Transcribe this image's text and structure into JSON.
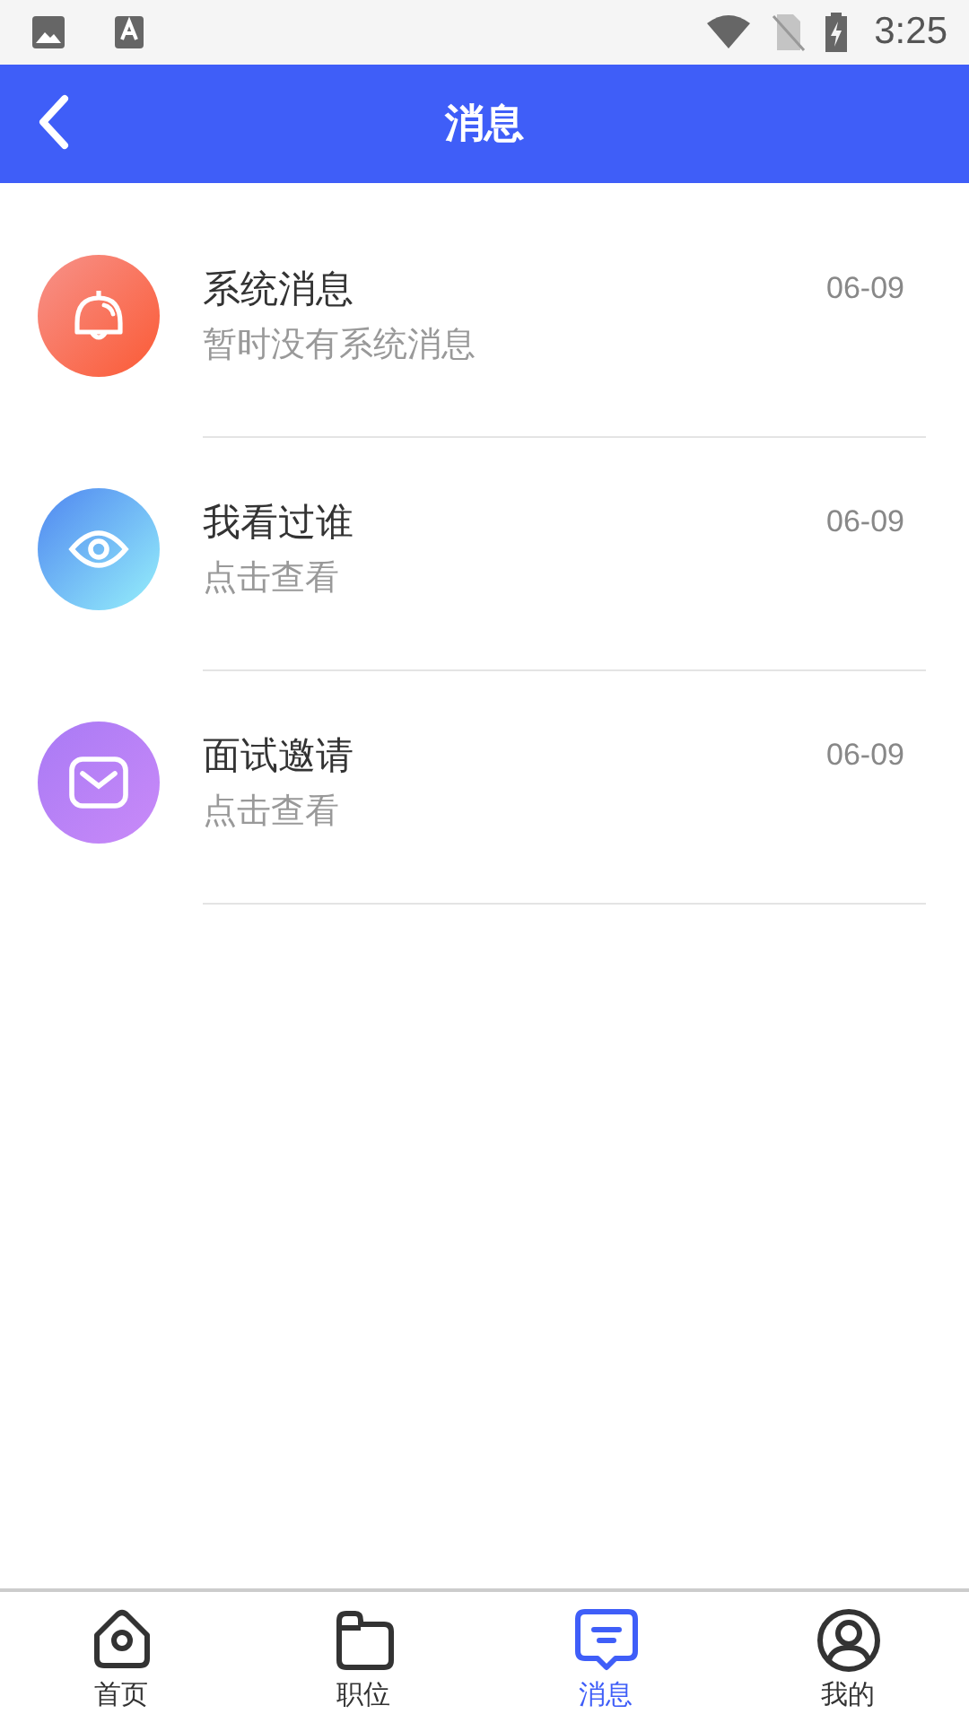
{
  "status_bar": {
    "time": "3:25"
  },
  "header": {
    "title": "消息"
  },
  "messages": [
    {
      "kind": "bell",
      "title": "系统消息",
      "subtitle": "暂时没有系统消息",
      "date": "06-09"
    },
    {
      "kind": "eye",
      "title": "我看过谁",
      "subtitle": "点击查看",
      "date": "06-09"
    },
    {
      "kind": "mail",
      "title": "面试邀请",
      "subtitle": "点击查看",
      "date": "06-09"
    }
  ],
  "tabs": [
    {
      "kind": "home",
      "label": "首页",
      "selected": false
    },
    {
      "kind": "folder",
      "label": "职位",
      "selected": false
    },
    {
      "kind": "chat",
      "label": "消息",
      "selected": true
    },
    {
      "kind": "user",
      "label": "我的",
      "selected": false
    }
  ]
}
